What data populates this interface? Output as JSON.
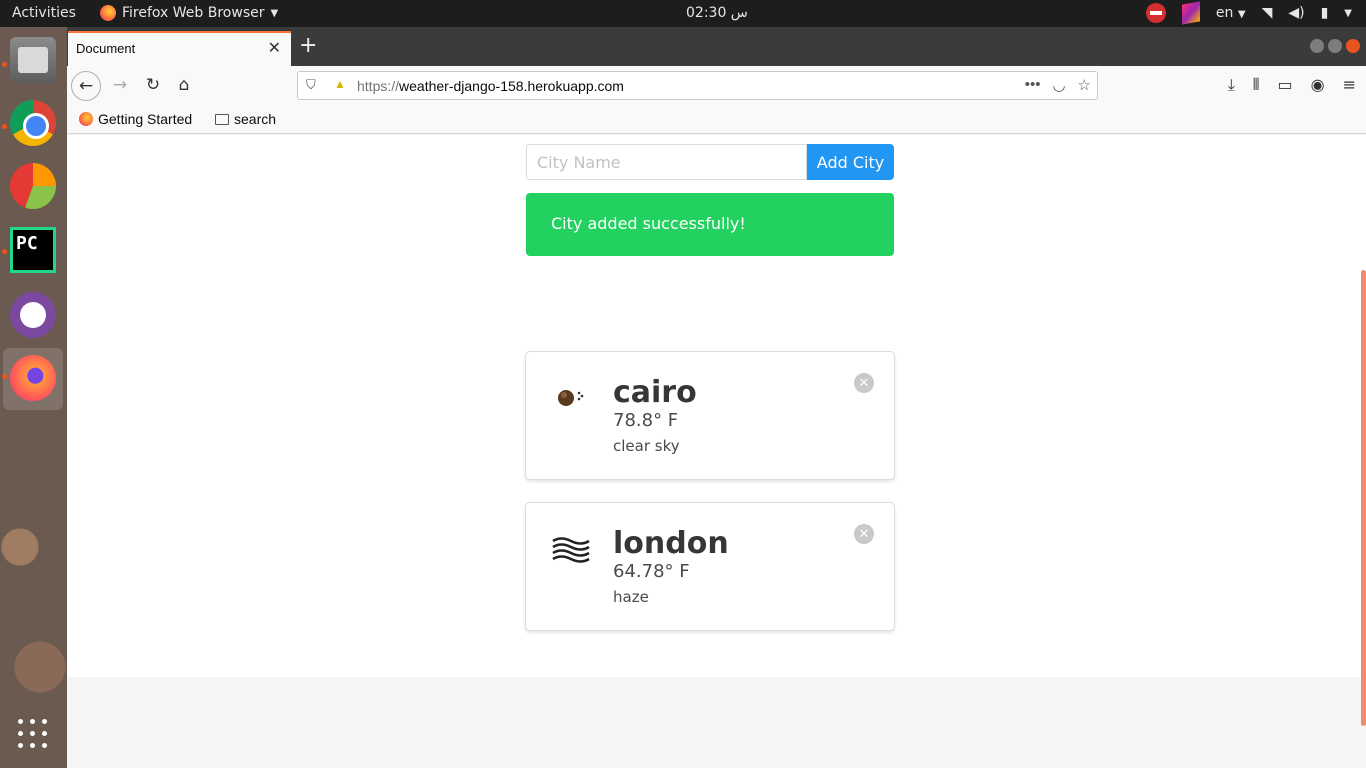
{
  "topbar": {
    "activities": "Activities",
    "app_name": "Firefox Web Browser",
    "clock": "02:30 س",
    "language": "en"
  },
  "dock": {
    "items": [
      "files-icon",
      "chrome-icon",
      "pie-app-icon",
      "pycharm-icon",
      "github-icon",
      "firefox-icon",
      "app-grid-icon"
    ],
    "pycharm_label": "PC"
  },
  "browser": {
    "tab_title": "Document",
    "url_scheme": "https://",
    "url_host": "weather-django-158.herokuapp.com",
    "bookmarks": [
      "Getting Started",
      "search"
    ]
  },
  "page": {
    "input_placeholder": "City Name",
    "add_button": "Add City",
    "notice": "City added successfully!",
    "cards": [
      {
        "city": "cairo",
        "temp": "78.8° F",
        "description": "clear sky",
        "icon": "clear-sky-icon"
      },
      {
        "city": "london",
        "temp": "64.78° F",
        "description": "haze",
        "icon": "haze-icon"
      }
    ]
  },
  "colors": {
    "accent": "#2196f3",
    "success": "#23d160",
    "ubuntu_orange": "#e95420"
  }
}
